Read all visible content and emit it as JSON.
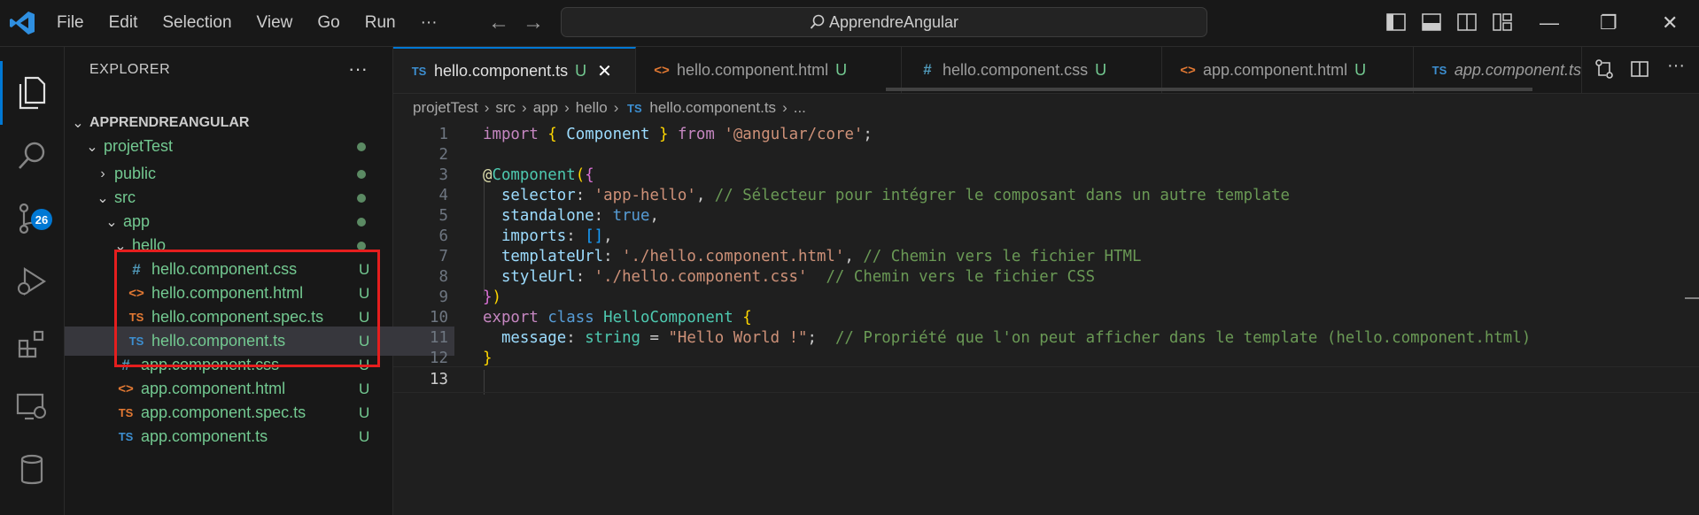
{
  "menu": [
    "File",
    "Edit",
    "Selection",
    "View",
    "Go",
    "Run",
    "···"
  ],
  "search": {
    "text": "ApprendreAngular"
  },
  "activity": {
    "badge": "26"
  },
  "explorer": {
    "title": "EXPLORER",
    "more": "···",
    "root": "APPRENDREANGULAR",
    "items": [
      {
        "label": "projetTest",
        "status": "dot"
      },
      {
        "label": "public",
        "status": "dot"
      },
      {
        "label": "src",
        "status": "dot"
      },
      {
        "label": "app",
        "status": "dot"
      },
      {
        "label": "hello",
        "status": "dot"
      },
      {
        "label": "hello.component.css",
        "icon": "#",
        "status": "U"
      },
      {
        "label": "hello.component.html",
        "icon": "<>",
        "status": "U"
      },
      {
        "label": "hello.component.spec.ts",
        "icon": "TS",
        "status": "U"
      },
      {
        "label": "hello.component.ts",
        "icon": "TS",
        "status": "U"
      },
      {
        "label": "app.component.css",
        "icon": "#",
        "status": "U"
      },
      {
        "label": "app.component.html",
        "icon": "<>",
        "status": "U"
      },
      {
        "label": "app.component.spec.ts",
        "icon": "TS",
        "status": "U"
      },
      {
        "label": "app.component.ts",
        "icon": "TS",
        "status": "U"
      }
    ]
  },
  "tabs": [
    {
      "icon": "TS",
      "label": "hello.component.ts",
      "status": "U",
      "close": "✕"
    },
    {
      "icon": "<>",
      "label": "hello.component.html",
      "status": "U"
    },
    {
      "icon": "#",
      "label": "hello.component.css",
      "status": "U"
    },
    {
      "icon": "<>",
      "label": "app.component.html",
      "status": "U"
    },
    {
      "icon": "TS",
      "label": "app.component.ts"
    }
  ],
  "breadcrumb": [
    "projetTest",
    "src",
    "app",
    "hello",
    "hello.component.ts",
    "..."
  ],
  "breadcrumb_icon": "TS",
  "code": {
    "line_numbers": [
      "1",
      "2",
      "3",
      "4",
      "5",
      "6",
      "7",
      "8",
      "9",
      "10",
      "11",
      "12",
      "13"
    ],
    "l1": {
      "import": "import",
      "ob": "{",
      "comp": "Component",
      "cb": "}",
      "from": "from",
      "mod": "'@angular/core'",
      "semi": ";"
    },
    "l3": {
      "at": "@",
      "name": "Component",
      "paren": "(",
      "brace": "{"
    },
    "l4": {
      "key": "selector",
      "colon": ": ",
      "val": "'app-hello'",
      "comma": ", ",
      "comment": "// Sélecteur pour intégrer le composant dans un autre template"
    },
    "l5": {
      "key": "standalone",
      "colon": ": ",
      "val": "true",
      "comma": ","
    },
    "l6": {
      "key": "imports",
      "colon": ": ",
      "val": "[]",
      "comma": ","
    },
    "l7": {
      "key": "templateUrl",
      "colon": ": ",
      "val": "'./hello.component.html'",
      "comma": ", ",
      "comment": "// Chemin vers le fichier HTML"
    },
    "l8": {
      "key": "styleUrl",
      "colon": ": ",
      "val": "'./hello.component.css'",
      "comma": "  ",
      "comment": "// Chemin vers le fichier CSS"
    },
    "l9": {
      "brace": "}",
      "paren": ")"
    },
    "l10": {
      "export": "export",
      "class": "class",
      "name": "HelloComponent",
      "brace": "{"
    },
    "l11": {
      "key": "message",
      "colon": ": ",
      "type": "string",
      "eq": " = ",
      "val": "\"Hello World !\"",
      "semi": ";  ",
      "comment": "// Propriété que l'on peut afficher dans le template (hello.component.html)"
    },
    "l12": {
      "brace": "}"
    }
  }
}
